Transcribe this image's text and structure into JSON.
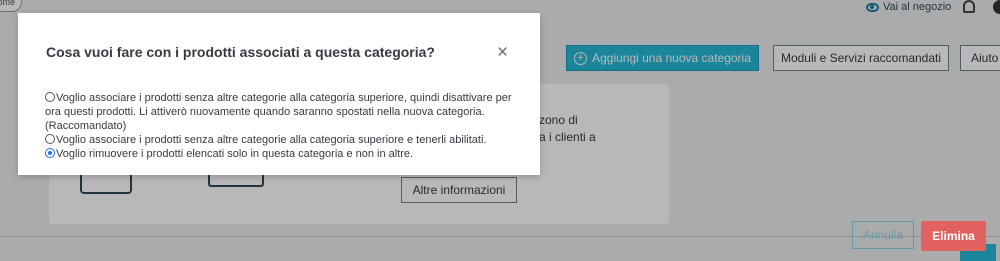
{
  "topbar": {
    "home_label": "ome",
    "store_link": "Vai al negozio"
  },
  "toolbar": {
    "add_category": "Aggiungi una nuova categoria",
    "modules": "Moduli e Servizi raccomandati",
    "help": "Aiuto"
  },
  "card": {
    "text_lines": [
      "zono di",
      "a i clienti a"
    ],
    "more_info": "Altre informazioni"
  },
  "footer": {
    "cancel": "Annulla",
    "delete": "Elimina"
  },
  "modal": {
    "title": "Cosa vuoi fare con i prodotti associati a questa categoria?",
    "close": "×",
    "options": [
      {
        "label": "Voglio associare i prodotti senza altre categorie alla categoria superiore, quindi disattivare per ora questi prodotti. Li attiverò nuovamente quando saranno spostati nella nuova categoria. (Raccomandato)",
        "checked": false
      },
      {
        "label": "Voglio associare i prodotti senza altre categorie alla categoria superiore e tenerli abilitati.",
        "checked": false
      },
      {
        "label": "Voglio rimuovere i prodotti elencati solo in questa categoria e non in altre.",
        "checked": true
      }
    ]
  },
  "colors": {
    "accent": "#24b9d7",
    "danger": "#e2625f"
  }
}
